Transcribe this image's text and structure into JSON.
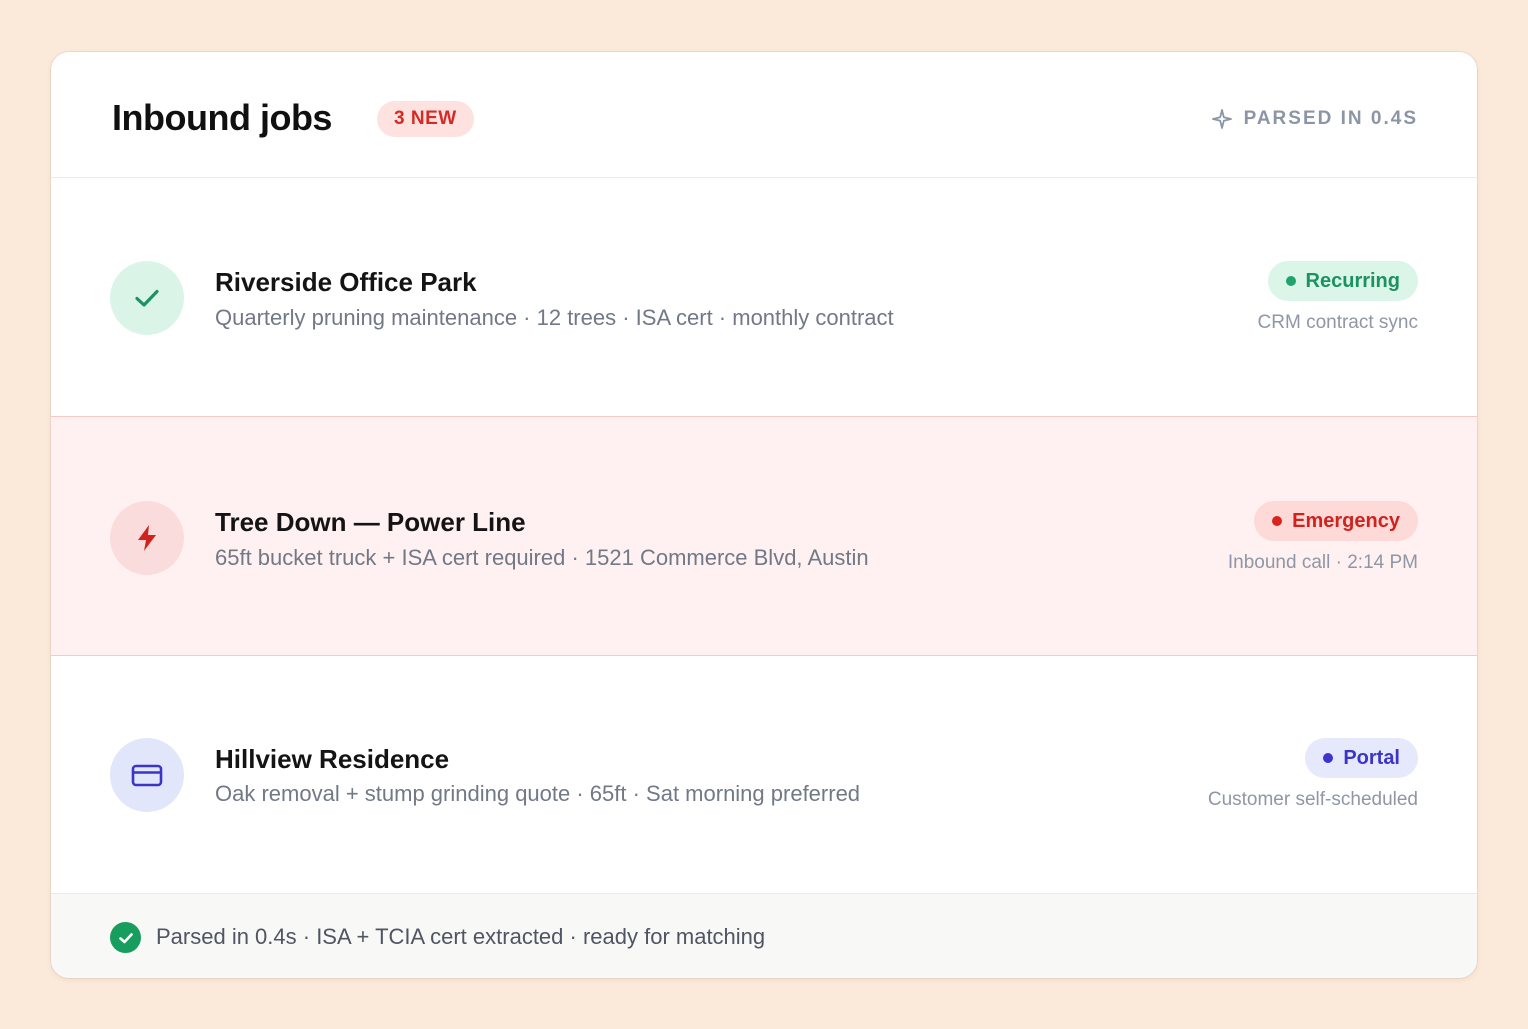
{
  "header": {
    "title": "Inbound jobs",
    "new_badge": "3 NEW",
    "parsed_label": "PARSED IN 0.4S"
  },
  "jobs": [
    {
      "title": "Riverside Office Park",
      "meta": "Quarterly pruning maintenance · 12 trees · ISA cert · monthly contract",
      "tag": "Recurring",
      "source": "CRM contract sync",
      "icon": "check-icon",
      "color": "#1a9360"
    },
    {
      "title": "Tree Down — Power Line",
      "meta": "65ft bucket truck + ISA cert required · 1521 Commerce Blvd, Austin",
      "tag": "Emergency",
      "source": "Inbound call · 2:14 PM",
      "icon": "lightning-icon",
      "color": "#d0231e"
    },
    {
      "title": "Hillview Residence",
      "meta": "Oak removal + stump grinding quote · 65ft · Sat morning preferred",
      "tag": "Portal",
      "source": "Customer self-scheduled",
      "icon": "credit-card-icon",
      "color": "#3c34c8"
    }
  ],
  "footer": {
    "status": "Parsed in 0.4s · ISA + TCIA cert extracted · ready for matching",
    "icon": "check-circle-icon"
  },
  "colors": {
    "background": "#fbe9d9",
    "accent_red": "#d62b24",
    "success_green": "#179e5e"
  }
}
